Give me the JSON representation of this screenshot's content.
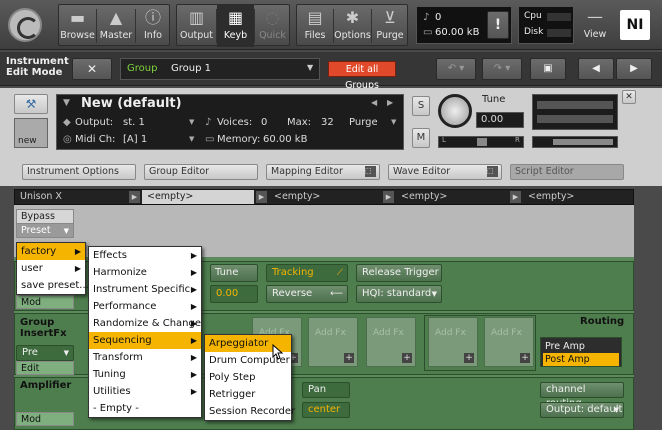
{
  "toolbar": {
    "browse": "Browse",
    "master": "Master",
    "info": "Info",
    "output": "Output",
    "keyb": "Keyb",
    "quick": "Quick",
    "files": "Files",
    "options": "Options",
    "purge": "Purge",
    "view": "View",
    "midi_value": "0",
    "memory": "60.00 kB",
    "cpu": "Cpu",
    "disk": "Disk",
    "alert": "!",
    "ni_logo": "NI"
  },
  "editbar": {
    "title_line1": "Instrument",
    "title_line2": "Edit Mode",
    "close": "✕",
    "group_label": "Group",
    "group_value": "Group 1",
    "edit_all_groups": "Edit all Groups"
  },
  "instrument": {
    "name": "New (default)",
    "output_label": "Output:",
    "output_value": "st. 1",
    "midi_label": "Midi Ch:",
    "midi_value": "[A]  1",
    "voices_label": "Voices:",
    "voices_value": "0",
    "max_label": "Max:",
    "max_value": "32",
    "memory_label": "Memory:",
    "memory_value": "60.00 kB",
    "purge": "Purge",
    "s_btn": "S",
    "m_btn": "M",
    "tune_label": "Tune",
    "tune_value": "0.00",
    "new_label": "new",
    "pan_l": "L",
    "pan_r": "R"
  },
  "editor_tabs": {
    "instrument_options": "Instrument Options",
    "group_editor": "Group Editor",
    "mapping_editor": "Mapping Editor",
    "wave_editor": "Wave Editor",
    "script_editor": "Script Editor"
  },
  "slots": {
    "first": "Unison X",
    "items": [
      "<empty>",
      "<empty>",
      "<empty>",
      "<empty>"
    ]
  },
  "script": {
    "bypass": "Bypass",
    "preset": "Preset"
  },
  "source": {
    "tune_label": "Tune",
    "tune_value": "0.00",
    "tracking": "Tracking",
    "reverse": "Reverse",
    "release_trigger": "Release Trigger",
    "hqi": "HQI: standard",
    "mod": "Mod"
  },
  "insertfx": {
    "title_line1": "Group",
    "title_line2": "InsertFx",
    "pre": "Pre",
    "edit": "Edit",
    "add_fx": "Add Fx",
    "routing": "Routing",
    "pre_amp": "Pre Amp",
    "post_amp": "Post Amp"
  },
  "amplifier": {
    "title": "Amplifier",
    "pan": "Pan",
    "pan_value": "center",
    "mod": "Mod",
    "channel_routing": "channel routing",
    "output": "Output: default"
  },
  "menus": {
    "preset_menu": [
      "factory",
      "user",
      "save preset..."
    ],
    "factory_menu": [
      "Effects",
      "Harmonize",
      "Instrument Specific",
      "Performance",
      "Randomize & Change",
      "Sequencing",
      "Transform",
      "Tuning",
      "Utilities",
      "- Empty -"
    ],
    "sequencing_menu": [
      "Arpeggiator",
      "Drum Computer",
      "Poly Step",
      "Retrigger",
      "Session Recorder"
    ]
  },
  "colors": {
    "accent_yellow": "#f5b400",
    "panel_green": "#5c8a5c",
    "edit_all_red": "#e04a2a",
    "group_green": "#7fd23c"
  }
}
